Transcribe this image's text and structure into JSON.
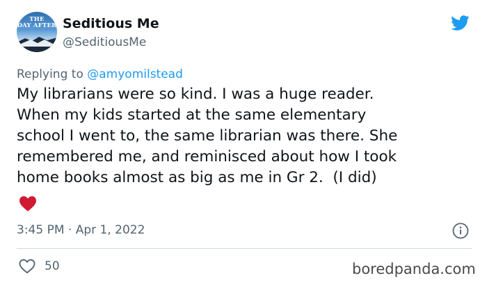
{
  "user": {
    "name": "Seditious Me",
    "handle": "@SeditiousMe",
    "avatar_text_line1": "THE",
    "avatar_text_line2": "DAY AFTER"
  },
  "tweet": {
    "reply_prefix": "Replying to ",
    "reply_to": "@amyomilstead",
    "text": "My librarians were so kind. I was a huge reader.\nWhen my kids started at the same elementary\nschool I went to, the same librarian was there. She\nremembered me, and reminisced about how I took\nhome books almost as big as me in Gr 2.  (I did)",
    "emoji": "red-heart-icon",
    "timestamp": "3:45 PM · Apr 1, 2022",
    "like_count": "50"
  },
  "icons": {
    "brand": "twitter-bird-icon",
    "info": "info-icon",
    "like": "heart-outline-icon"
  },
  "watermark": "boredpanda.com",
  "colors": {
    "twitter_blue": "#1d9bf0",
    "text_primary": "#0f1419",
    "text_secondary": "#536471",
    "heart_red": "#d01933",
    "divider": "#cfd9de"
  }
}
